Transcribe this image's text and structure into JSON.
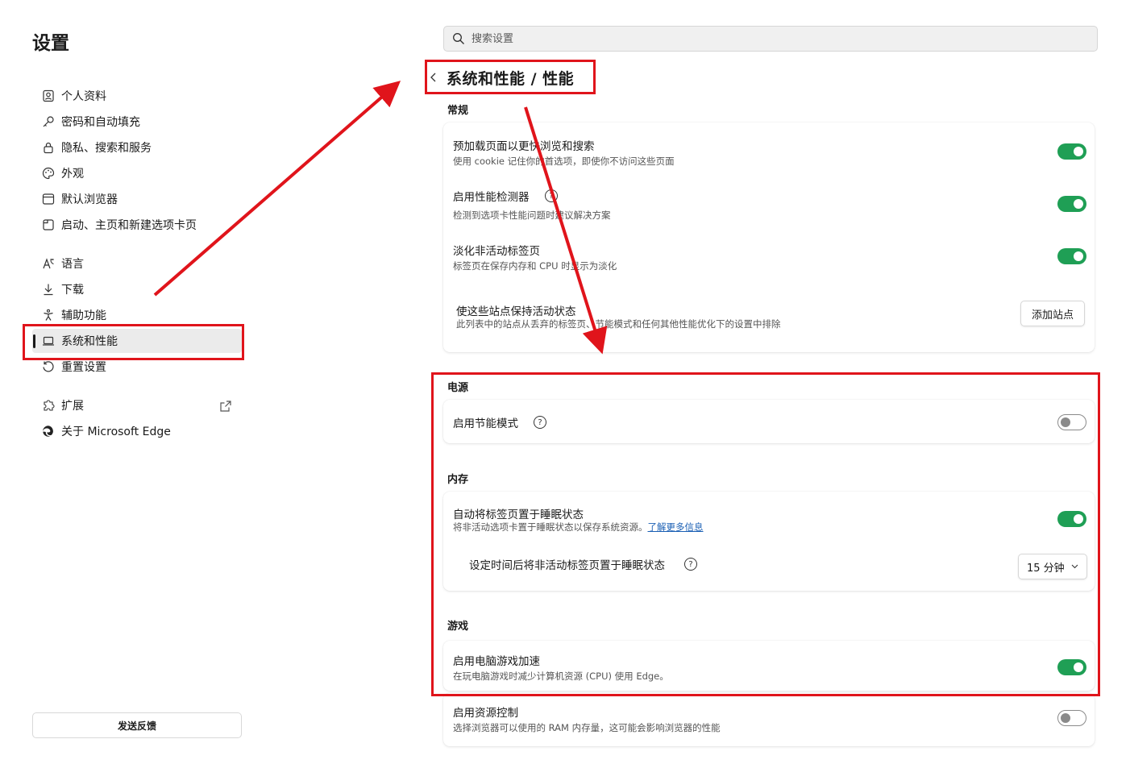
{
  "sidebar": {
    "title": "设置",
    "items": [
      {
        "label": "个人资料",
        "icon": "profile-icon"
      },
      {
        "label": "密码和自动填充",
        "icon": "key-icon"
      },
      {
        "label": "隐私、搜索和服务",
        "icon": "lock-icon"
      },
      {
        "label": "外观",
        "icon": "palette-icon"
      },
      {
        "label": "默认浏览器",
        "icon": "browser-icon"
      },
      {
        "label": "启动、主页和新建选项卡页",
        "icon": "tabs-icon"
      },
      {
        "label": "语言",
        "icon": "language-icon"
      },
      {
        "label": "下载",
        "icon": "download-icon"
      },
      {
        "label": "辅助功能",
        "icon": "accessibility-icon"
      },
      {
        "label": "系统和性能",
        "icon": "laptop-icon",
        "active": true
      },
      {
        "label": "重置设置",
        "icon": "reset-icon"
      },
      {
        "label": "扩展",
        "icon": "puzzle-icon"
      },
      {
        "label": "关于 Microsoft Edge",
        "icon": "edge-icon"
      }
    ],
    "feedback_label": "发送反馈"
  },
  "search": {
    "placeholder": "搜索设置"
  },
  "breadcrumb": "系统和性能 / 性能",
  "sections": {
    "general": "常规",
    "power": "电源",
    "memory": "内存",
    "gaming": "游戏"
  },
  "rows": {
    "preload": {
      "title": "预加载页面以更快浏览和搜索",
      "desc": "使用 cookie 记住你的首选项，即使你不访问这些页面",
      "enabled": true
    },
    "monitor": {
      "title": "启用性能检测器",
      "desc": "检测到选项卡性能问题时建议解决方案",
      "enabled": true
    },
    "fade": {
      "title": "淡化非活动标签页",
      "desc": "标签页在保存内存和 CPU 时显示为淡化",
      "enabled": true
    },
    "keep_active": {
      "title": "使这些站点保持活动状态",
      "desc": "此列表中的站点从丢弃的标签页、节能模式和任何其他性能优化下的设置中排除",
      "button": "添加站点"
    },
    "efficiency": {
      "title": "启用节能模式",
      "enabled": false
    },
    "sleep": {
      "title": "自动将标签页置于睡眠状态",
      "desc": "将非活动选项卡置于睡眠状态以保存系统资源。",
      "link": "了解更多信息",
      "enabled": true
    },
    "sleep_time": {
      "title": "设定时间后将非活动标签页置于睡眠状态",
      "value": "15 分钟"
    },
    "game": {
      "title": "启用电脑游戏加速",
      "desc": "在玩电脑游戏时减少计算机资源 (CPU) 使用 Edge。",
      "enabled": true
    },
    "resource": {
      "title": "启用资源控制",
      "desc": "选择浏览器可以使用的 RAM 内存量，这可能会影响浏览器的性能",
      "enabled": false
    }
  },
  "colors": {
    "accent": "#1f9f55",
    "annotation": "#e0141b",
    "link": "#1a5fb4"
  }
}
